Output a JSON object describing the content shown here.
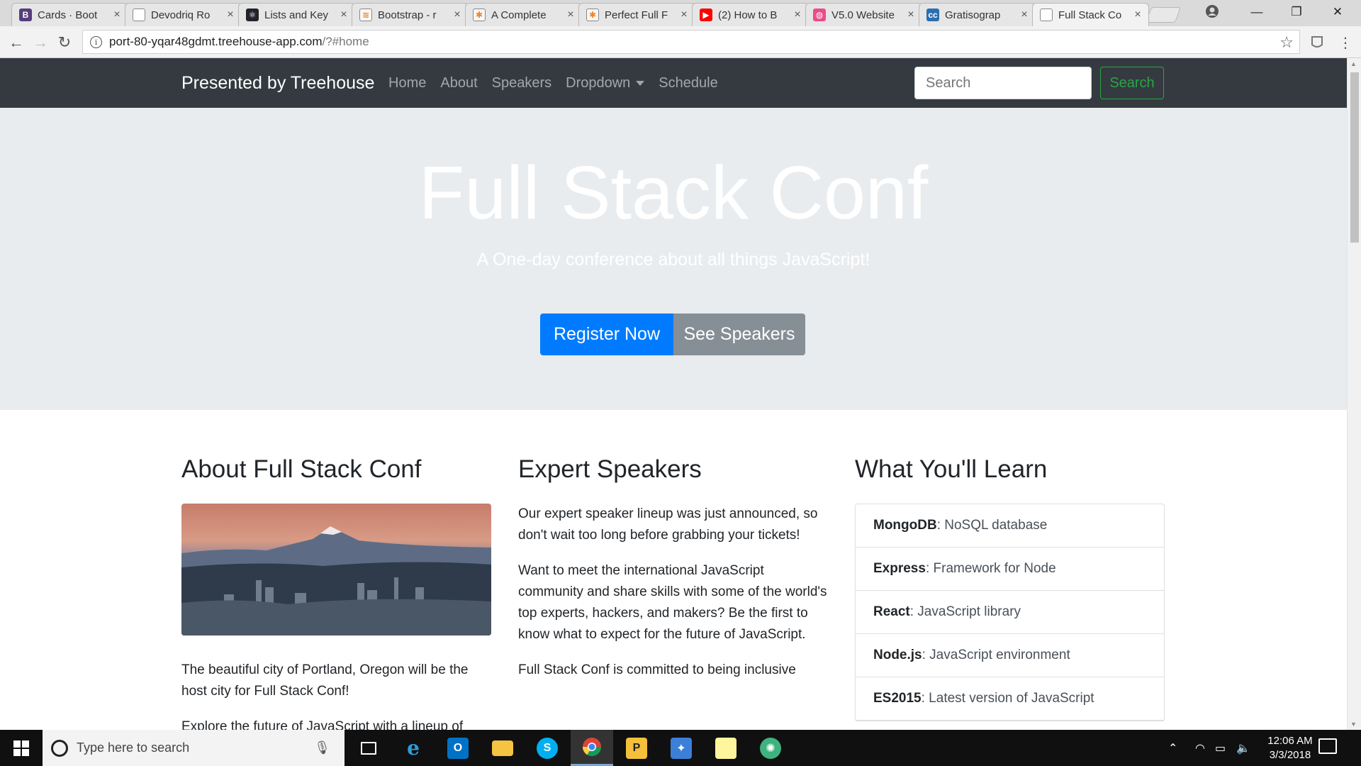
{
  "browser": {
    "tabs": [
      {
        "title": "Cards · Boot",
        "favicon": "bootstrap-b",
        "color": "#563d7c",
        "glyph": "B"
      },
      {
        "title": "Devodriq Ro",
        "favicon": "page-icon",
        "color": "#ffffff",
        "glyph": ""
      },
      {
        "title": "Lists and Key",
        "favicon": "react-icon",
        "color": "#20232a",
        "glyph": "⚛"
      },
      {
        "title": "Bootstrap - r",
        "favicon": "flame-icon",
        "color": "#f8f8f8",
        "glyph": "≋"
      },
      {
        "title": "A Complete",
        "favicon": "asterisk-icon",
        "color": "#f7f7f7",
        "glyph": "✱"
      },
      {
        "title": "Perfect Full F",
        "favicon": "asterisk-icon",
        "color": "#f7f7f7",
        "glyph": "✱"
      },
      {
        "title": "(2) How to B",
        "favicon": "youtube-icon",
        "color": "#ff0000",
        "glyph": "▶"
      },
      {
        "title": "V5.0 Website",
        "favicon": "dribbble-icon",
        "color": "#ea4c89",
        "glyph": "◍"
      },
      {
        "title": "Gratisograp",
        "favicon": "cc-icon",
        "color": "#2a6fb0",
        "glyph": "cc"
      },
      {
        "title": "Full Stack Co",
        "favicon": "page-icon",
        "color": "#ffffff",
        "glyph": "",
        "active": true
      }
    ],
    "url_host": "port-80-yqar48gdmt.treehouse-app.com",
    "url_path": "/?#home"
  },
  "navbar": {
    "brand": "Presented by Treehouse",
    "links": [
      "Home",
      "About",
      "Speakers",
      "Dropdown",
      "Schedule"
    ],
    "search_placeholder": "Search",
    "search_button": "Search"
  },
  "hero": {
    "title": "Full Stack Conf",
    "subtitle": "A One-day conference about all things JavaScript!",
    "register_label": "Register Now",
    "speakers_label": "See Speakers"
  },
  "about": {
    "heading": "About Full Stack Conf",
    "p1": "The beautiful city of Portland, Oregon will be the host city for Full Stack Conf!",
    "p2": "Explore the future of JavaScript with a lineup of"
  },
  "speakers": {
    "heading": "Expert Speakers",
    "p1": "Our expert speaker lineup was just announced, so don't wait too long before grabbing your tickets!",
    "p2": "Want to meet the international JavaScript community and share skills with some of the world's top experts, hackers, and makers? Be the first to know what to expect for the future of JavaScript.",
    "p3": "Full Stack Conf is committed to being inclusive"
  },
  "learn": {
    "heading": "What You'll Learn",
    "items": [
      {
        "term": "MongoDB",
        "desc": ": NoSQL database"
      },
      {
        "term": "Express",
        "desc": ": Framework for Node"
      },
      {
        "term": "React",
        "desc": ": JavaScript library"
      },
      {
        "term": "Node.js",
        "desc": ": JavaScript environment"
      },
      {
        "term": "ES2015",
        "desc": ": Latest version of JavaScript"
      }
    ]
  },
  "taskbar": {
    "search_placeholder": "Type here to search",
    "time": "12:06 AM",
    "date": "3/3/2018"
  },
  "colors": {
    "navbar_bg": "#343a40",
    "jumbotron_bg": "#e9ecef",
    "primary": "#007bff",
    "secondary": "#868e96",
    "success": "#28a745"
  }
}
